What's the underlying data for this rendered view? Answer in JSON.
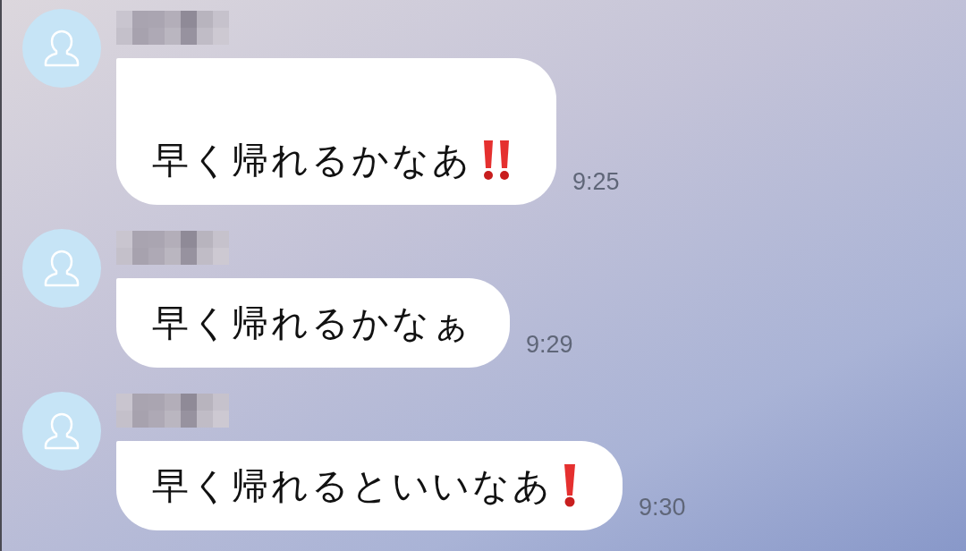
{
  "messages": [
    {
      "name_redacted": true,
      "leading_blank_line": true,
      "text": "早く帰れるかなあ",
      "trailing_icon": {
        "kind": "double_exclamation"
      },
      "time": "9:25"
    },
    {
      "name_redacted": true,
      "leading_blank_line": false,
      "text": "早く帰れるかなぁ",
      "time": "9:29"
    },
    {
      "name_redacted": true,
      "leading_blank_line": false,
      "text": "早く帰れるといいなあ",
      "trailing_icon": {
        "kind": "exclamation"
      },
      "time": "9:30"
    }
  ]
}
